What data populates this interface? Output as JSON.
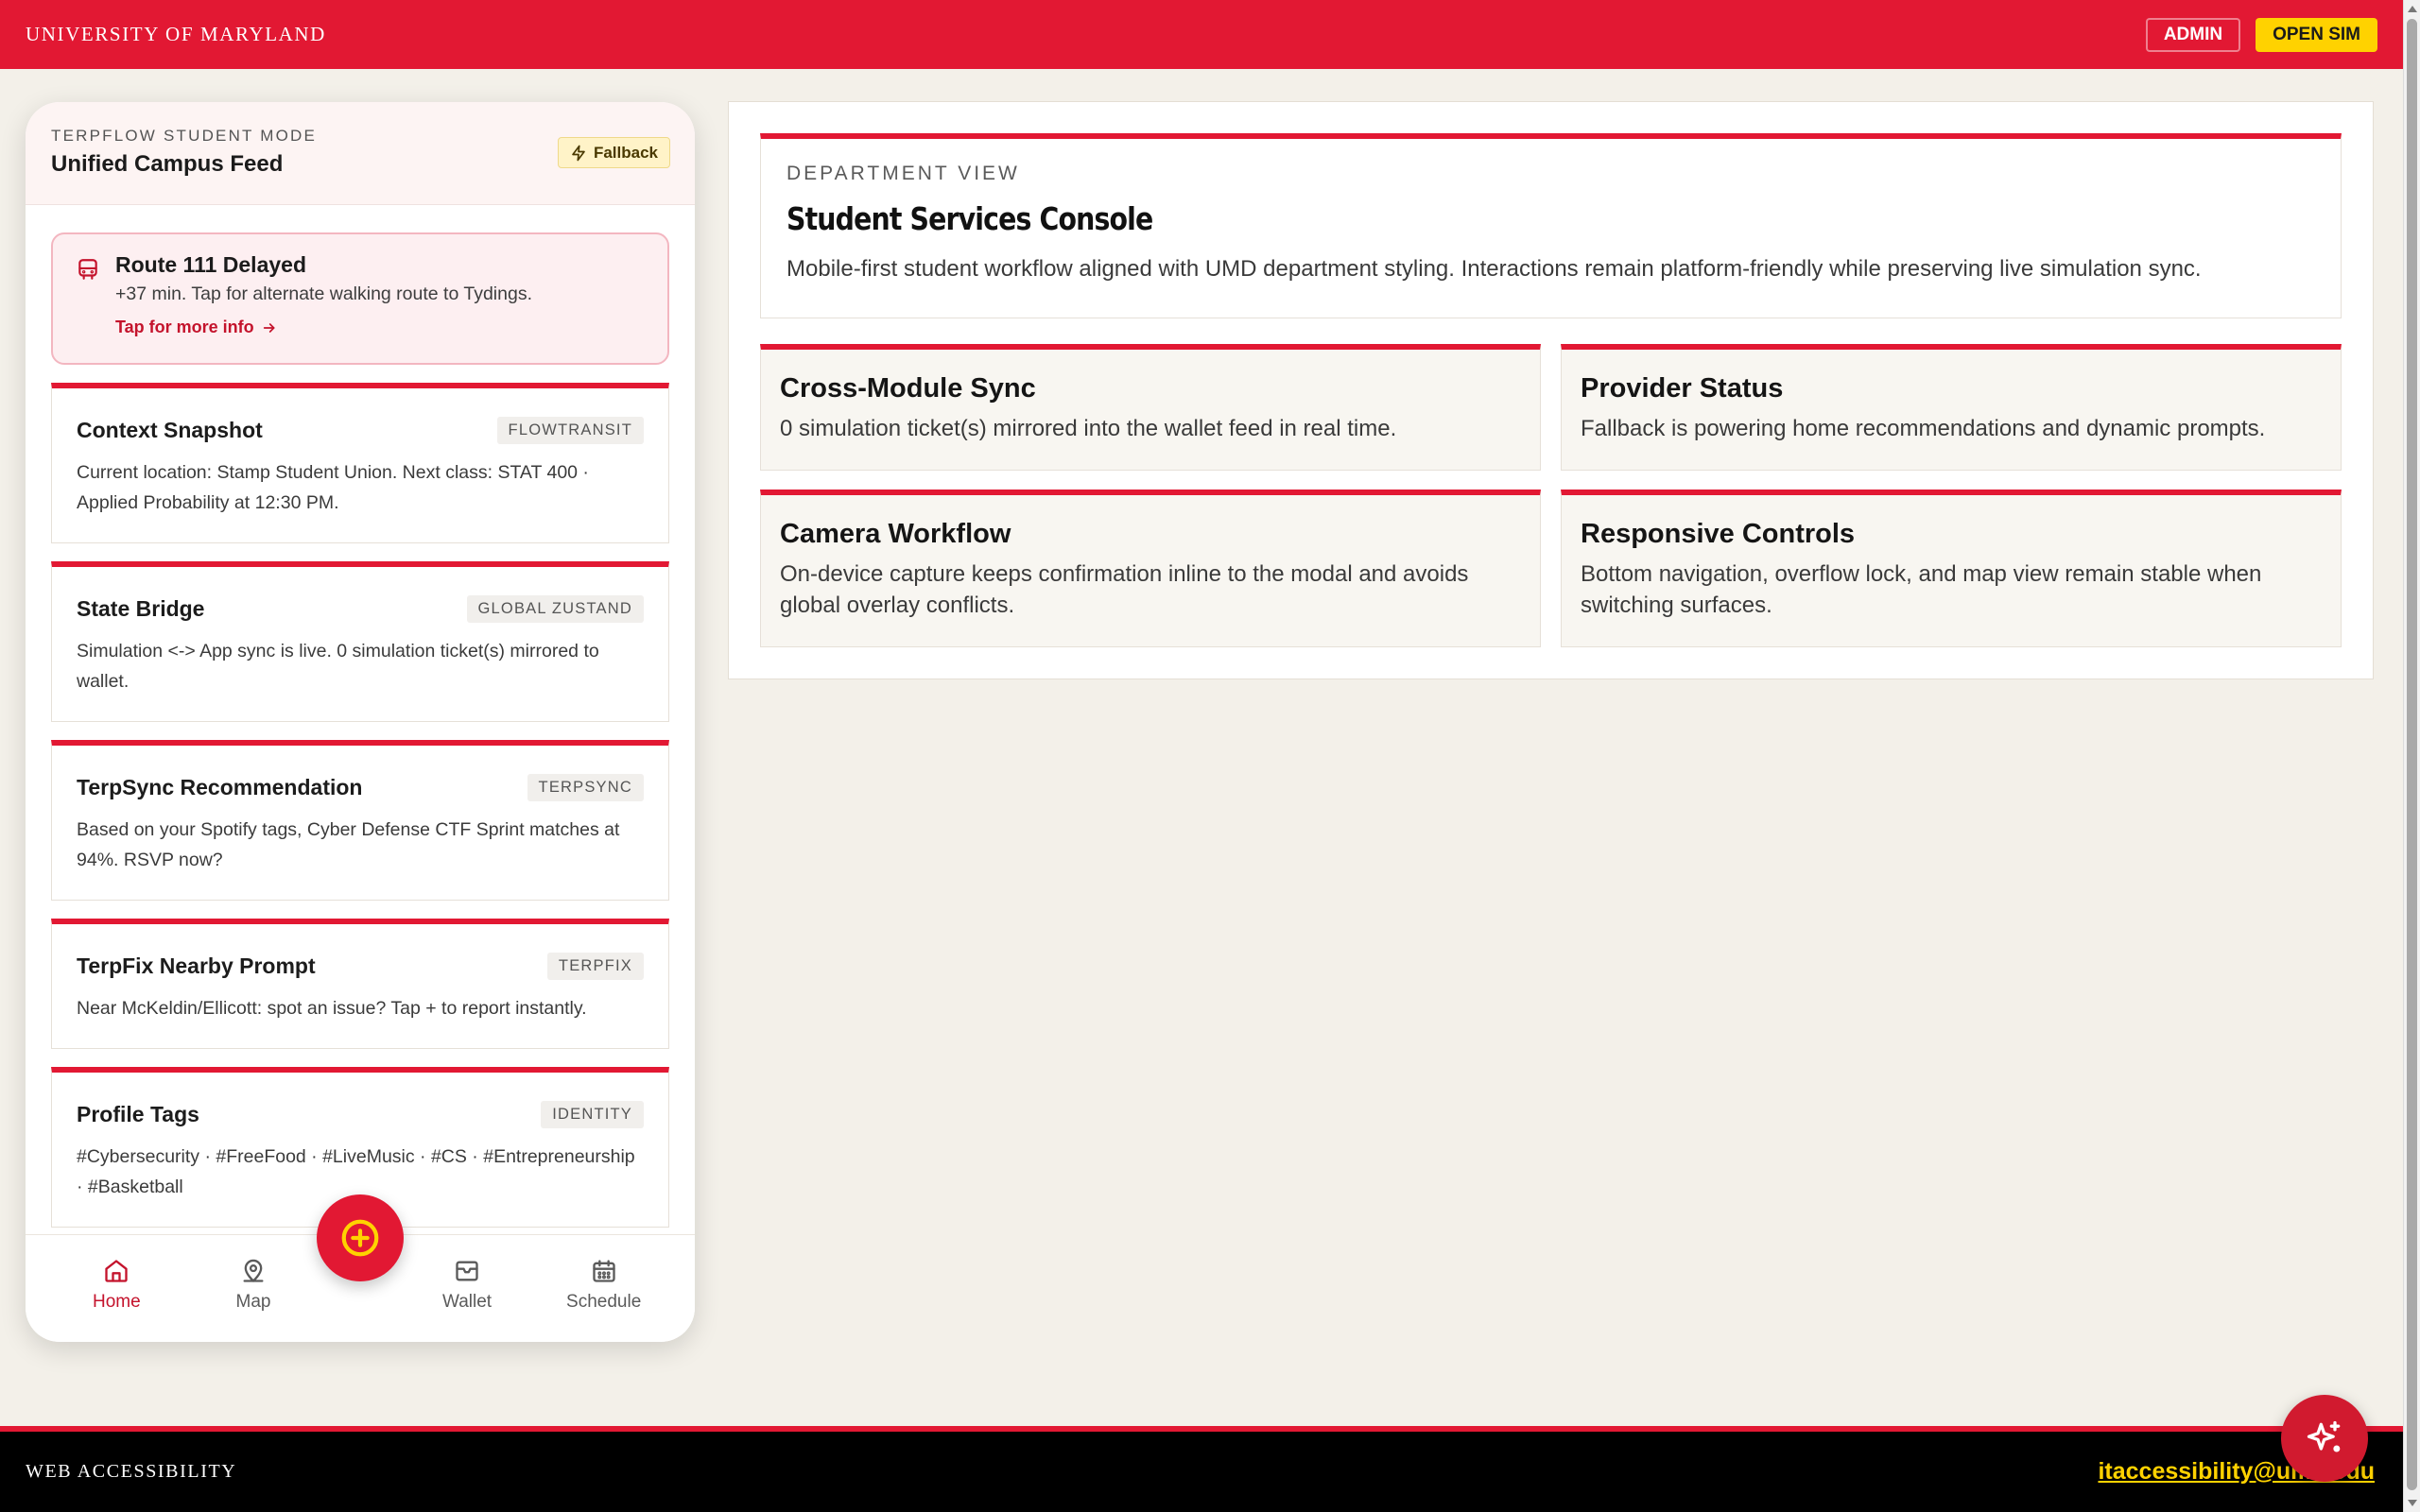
{
  "header": {
    "brand": "UNIVERSITY OF MARYLAND",
    "admin_label": "ADMIN",
    "open_sim_label": "OPEN SIM"
  },
  "phone": {
    "mode_label": "TERPFLOW STUDENT MODE",
    "feed_title": "Unified Campus Feed",
    "provider_badge": "Fallback",
    "alert": {
      "icon": "bus-icon",
      "title": "Route 111 Delayed",
      "text": "+37 min. Tap for alternate walking route to Tydings.",
      "link": "Tap for more info"
    },
    "cards": [
      {
        "title": "Context Snapshot",
        "tag": "FLOWTRANSIT",
        "text": "Current location: Stamp Student Union. Next class: STAT 400 · Applied Probability at 12:30 PM."
      },
      {
        "title": "State Bridge",
        "tag": "GLOBAL ZUSTAND",
        "text": "Simulation <-> App sync is live. 0 simulation ticket(s) mirrored to wallet."
      },
      {
        "title": "TerpSync Recommendation",
        "tag": "TERPSYNC",
        "text": "Based on your Spotify tags, Cyber Defense CTF Sprint matches at 94%. RSVP now?"
      },
      {
        "title": "TerpFix Nearby Prompt",
        "tag": "TERPFIX",
        "text": "Near McKeldin/Ellicott: spot an issue? Tap + to report instantly."
      },
      {
        "title": "Profile Tags",
        "tag": "IDENTITY",
        "text": "#Cybersecurity · #FreeFood · #LiveMusic · #CS · #Entrepreneurship · #Basketball"
      }
    ],
    "nav": {
      "home": "Home",
      "map": "Map",
      "wallet": "Wallet",
      "schedule": "Schedule",
      "active": "home"
    }
  },
  "console": {
    "dept_label": "DEPARTMENT VIEW",
    "title": "Student Services Console",
    "description": "Mobile-first student workflow aligned with UMD department styling. Interactions remain platform-friendly while preserving live simulation sync.",
    "tiles": [
      {
        "title": "Cross-Module Sync",
        "text": "0 simulation ticket(s) mirrored into the wallet feed in real time."
      },
      {
        "title": "Provider Status",
        "text": "Fallback is powering home recommendations and dynamic prompts."
      },
      {
        "title": "Camera Workflow",
        "text": "On-device capture keeps confirmation inline to the modal and avoids global overlay conflicts."
      },
      {
        "title": "Responsive Controls",
        "text": "Bottom navigation, overflow lock, and map view remain stable when switching surfaces."
      }
    ]
  },
  "footer": {
    "left": "WEB ACCESSIBILITY",
    "email": "itaccessibility@umd.edu"
  },
  "colors": {
    "brand_red": "#e21833",
    "brand_gold": "#ffd200",
    "background": "#f3f0e9"
  }
}
